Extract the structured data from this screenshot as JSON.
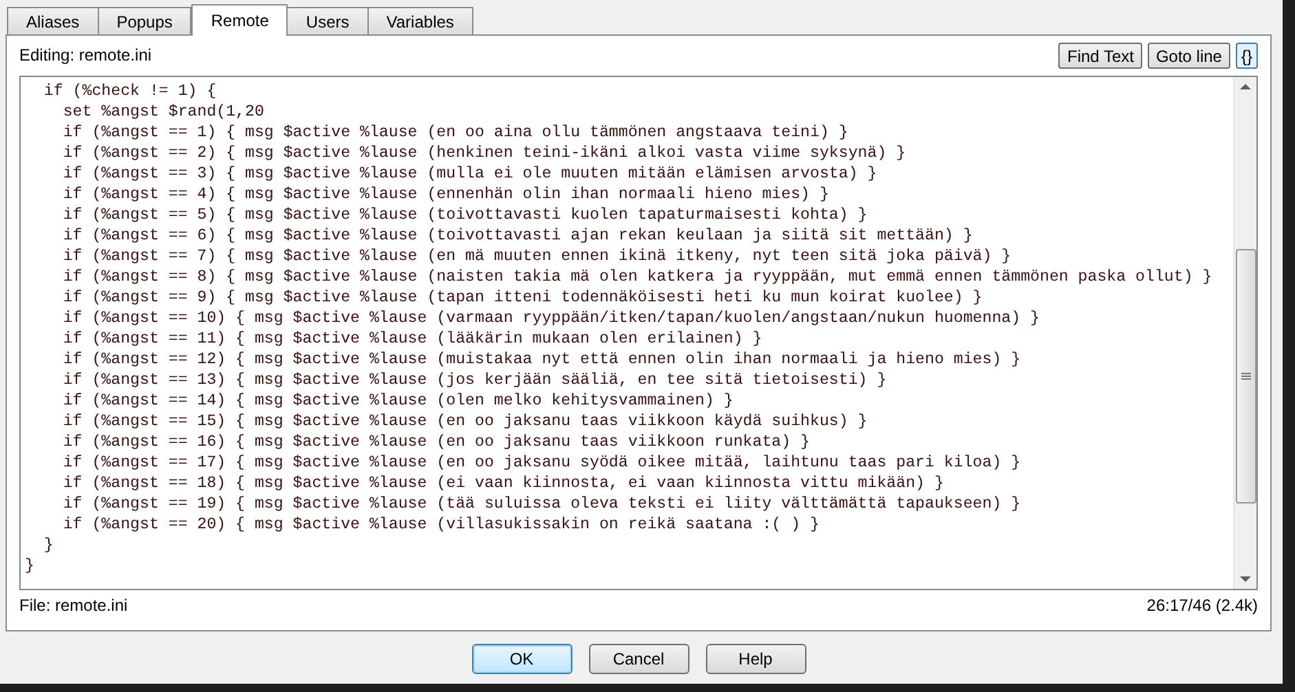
{
  "tabs": [
    {
      "label": "Aliases",
      "selected": false
    },
    {
      "label": "Popups",
      "selected": false
    },
    {
      "label": "Remote",
      "selected": true
    },
    {
      "label": "Users",
      "selected": false
    },
    {
      "label": "Variables",
      "selected": false
    }
  ],
  "editing_label": "Editing: remote.ini",
  "toolbar_buttons": [
    {
      "label": "Find Text",
      "kind": "text"
    },
    {
      "label": "Goto line",
      "kind": "text"
    },
    {
      "label": "{}",
      "kind": "brace"
    }
  ],
  "code_lines": [
    "  if (%check != 1) {",
    "    set %angst $rand(1,20",
    "    if (%angst == 1) { msg $active %lause (en oo aina ollu tämmönen angstaava teini) }",
    "    if (%angst == 2) { msg $active %lause (henkinen teini-ikäni alkoi vasta viime syksynä) }",
    "    if (%angst == 3) { msg $active %lause (mulla ei ole muuten mitään elämisen arvosta) }",
    "    if (%angst == 4) { msg $active %lause (ennenhän olin ihan normaali hieno mies) }",
    "    if (%angst == 5) { msg $active %lause (toivottavasti kuolen tapaturmaisesti kohta) }",
    "    if (%angst == 6) { msg $active %lause (toivottavasti ajan rekan keulaan ja siitä sit mettään) }",
    "    if (%angst == 7) { msg $active %lause (en mä muuten ennen ikinä itkeny, nyt teen sitä joka päivä) }",
    "    if (%angst == 8) { msg $active %lause (naisten takia mä olen katkera ja ryyppään, mut emmä ennen tämmönen paska ollut) }",
    "    if (%angst == 9) { msg $active %lause (tapan itteni todennäköisesti heti ku mun koirat kuolee) }",
    "    if (%angst == 10) { msg $active %lause (varmaan ryyppään/itken/tapan/kuolen/angstaan/nukun huomenna) }",
    "    if (%angst == 11) { msg $active %lause (lääkärin mukaan olen erilainen) }",
    "    if (%angst == 12) { msg $active %lause (muistakaa nyt että ennen olin ihan normaali ja hieno mies) }",
    "    if (%angst == 13) { msg $active %lause (jos kerjään sääliä, en tee sitä tietoisesti) }",
    "    if (%angst == 14) { msg $active %lause (olen melko kehitysvammainen) }",
    "    if (%angst == 15) { msg $active %lause (en oo jaksanu taas viikkoon käydä suihkus) }",
    "    if (%angst == 16) { msg $active %lause (en oo jaksanu taas viikkoon runkata) }",
    "    if (%angst == 17) { msg $active %lause (en oo jaksanu syödä oikee mitää, laihtunu taas pari kiloa) }",
    "    if (%angst == 18) { msg $active %lause (ei vaan kiinnosta, ei vaan kiinnosta vittu mikään) }",
    "    if (%angst == 19) { msg $active %lause (tää suluissa oleva teksti ei liity välttämättä tapaukseen) }",
    "    if (%angst == 20) { msg $active %lause (villasukissakin on reikä saatana :( ) }",
    "  }",
    "}"
  ],
  "status_bar": {
    "file": "File: remote.ini",
    "position": "26:17/46 (2.4k)"
  },
  "dialog_buttons": [
    {
      "label": "OK",
      "selected": true
    },
    {
      "label": "Cancel",
      "selected": false
    },
    {
      "label": "Help",
      "selected": false
    }
  ]
}
